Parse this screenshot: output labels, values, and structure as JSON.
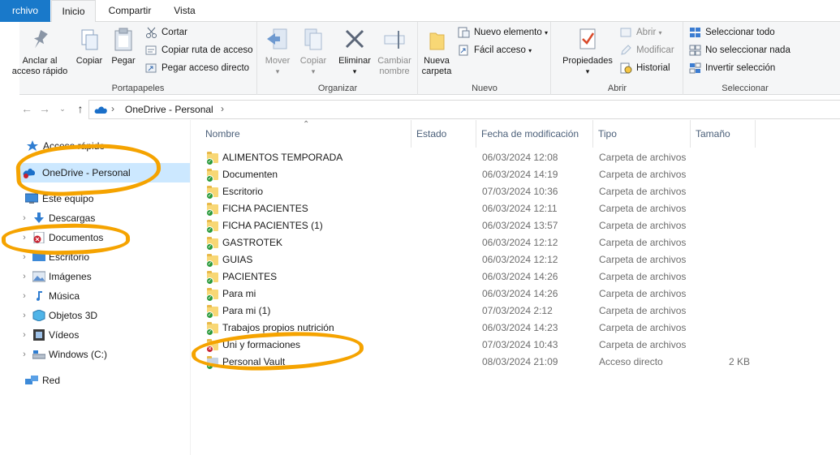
{
  "tabs": [
    {
      "label": "rchivo"
    },
    {
      "label": "Inicio"
    },
    {
      "label": "Compartir"
    },
    {
      "label": "Vista"
    }
  ],
  "ribbon": {
    "portapapeles": {
      "label": "Portapapeles",
      "pin": "Anclar al acceso rápido",
      "copy": "Copiar",
      "paste": "Pegar",
      "cut": "Cortar",
      "copy_path": "Copiar ruta de acceso",
      "paste_shortcut": "Pegar acceso directo"
    },
    "organizar": {
      "label": "Organizar",
      "move": "Mover",
      "copy_to": "Copiar",
      "delete": "Eliminar",
      "rename": "Cambiar nombre"
    },
    "nuevo": {
      "label": "Nuevo",
      "new_folder": "Nueva carpeta",
      "new_item": "Nuevo elemento",
      "easy_access": "Fácil acceso"
    },
    "abrir": {
      "label": "Abrir",
      "properties": "Propiedades",
      "open": "Abrir",
      "edit": "Modificar",
      "history": "Historial"
    },
    "seleccionar": {
      "label": "Seleccionar",
      "select_all": "Seleccionar todo",
      "select_none": "No seleccionar nada",
      "invert": "Invertir selección"
    }
  },
  "address": {
    "crumb": "OneDrive - Personal"
  },
  "nav": {
    "items": [
      {
        "label": "Acceso rápido"
      },
      {
        "label": "OneDrive - Personal"
      },
      {
        "label": "Este equipo"
      },
      {
        "label": "Descargas"
      },
      {
        "label": "Documentos"
      },
      {
        "label": "Escritorio"
      },
      {
        "label": "Imágenes"
      },
      {
        "label": "Música"
      },
      {
        "label": "Objetos 3D"
      },
      {
        "label": "Vídeos"
      },
      {
        "label": "Windows (C:)"
      },
      {
        "label": "Red"
      }
    ]
  },
  "columns": {
    "name": "Nombre",
    "status": "Estado",
    "date": "Fecha de modificación",
    "type": "Tipo",
    "size": "Tamaño"
  },
  "files": [
    {
      "name": "ALIMENTOS TEMPORADA",
      "date": "06/03/2024 12:08",
      "type": "Carpeta de archivos",
      "size": "",
      "status": "ok"
    },
    {
      "name": "Documenten",
      "date": "06/03/2024 14:19",
      "type": "Carpeta de archivos",
      "size": "",
      "status": "ok"
    },
    {
      "name": "Escritorio",
      "date": "07/03/2024 10:36",
      "type": "Carpeta de archivos",
      "size": "",
      "status": "ok"
    },
    {
      "name": "FICHA PACIENTES",
      "date": "06/03/2024 12:11",
      "type": "Carpeta de archivos",
      "size": "",
      "status": "ok"
    },
    {
      "name": "FICHA PACIENTES (1)",
      "date": "06/03/2024 13:57",
      "type": "Carpeta de archivos",
      "size": "",
      "status": "ok"
    },
    {
      "name": "GASTROTEK",
      "date": "06/03/2024 12:12",
      "type": "Carpeta de archivos",
      "size": "",
      "status": "ok"
    },
    {
      "name": "GUIAS",
      "date": "06/03/2024 12:12",
      "type": "Carpeta de archivos",
      "size": "",
      "status": "ok"
    },
    {
      "name": "PACIENTES",
      "date": "06/03/2024 14:26",
      "type": "Carpeta de archivos",
      "size": "",
      "status": "ok"
    },
    {
      "name": "Para mi",
      "date": "06/03/2024 14:26",
      "type": "Carpeta de archivos",
      "size": "",
      "status": "ok"
    },
    {
      "name": "Para mi (1)",
      "date": "07/03/2024 2:12",
      "type": "Carpeta de archivos",
      "size": "",
      "status": "ok"
    },
    {
      "name": "Trabajos propios nutrición",
      "date": "06/03/2024 14:23",
      "type": "Carpeta de archivos",
      "size": "",
      "status": "ok"
    },
    {
      "name": "Uni y formaciones",
      "date": "07/03/2024 10:43",
      "type": "Carpeta de archivos",
      "size": "",
      "status": "err"
    },
    {
      "name": "Personal Vault",
      "date": "08/03/2024 21:09",
      "type": "Acceso directo",
      "size": "2 KB",
      "status": "ok"
    }
  ],
  "colors": {
    "accent": "#1979ca",
    "selection": "#cce8ff",
    "highlight": "#f5a300",
    "sync_ok": "#2a9a3c",
    "sync_error": "#c8202e"
  }
}
